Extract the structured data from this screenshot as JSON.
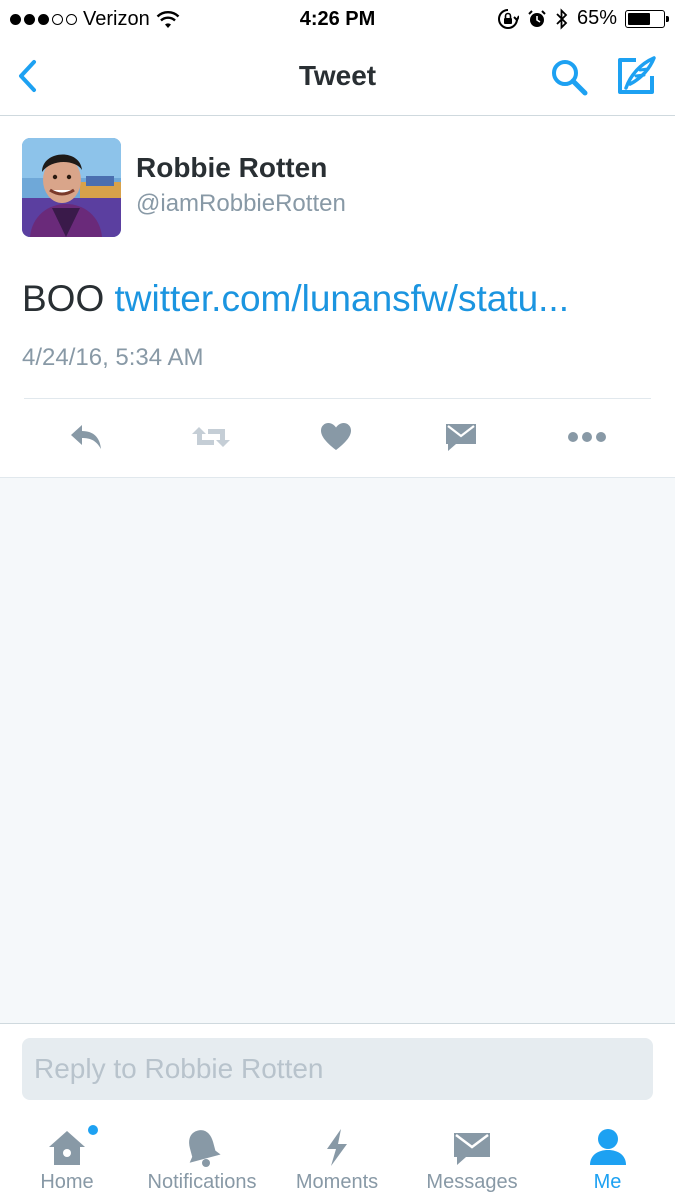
{
  "status_bar": {
    "carrier": "Verizon",
    "time": "4:26 PM",
    "battery": "65%",
    "battery_level": 0.65,
    "signal_bars_filled": 3,
    "signal_bars_total": 5
  },
  "nav": {
    "title": "Tweet",
    "back_icon": "chevron-left-icon",
    "search_icon": "search-icon",
    "compose_icon": "compose-icon"
  },
  "tweet": {
    "author_name": "Robbie Rotten",
    "author_handle": "@iamRobbieRotten",
    "text": "BOO",
    "link": "twitter.com/lunansfw/statu...",
    "timestamp": "4/24/16, 5:34 AM",
    "actions": [
      "reply-icon",
      "retweet-icon",
      "like-icon",
      "direct-message-icon",
      "more-icon"
    ]
  },
  "reply": {
    "placeholder": "Reply to Robbie Rotten"
  },
  "tabbar": {
    "tabs": [
      {
        "label": "Home",
        "icon": "home-icon",
        "has_badge": true
      },
      {
        "label": "Notifications",
        "icon": "bell-icon"
      },
      {
        "label": "Moments",
        "icon": "lightning-icon"
      },
      {
        "label": "Messages",
        "icon": "envelope-icon"
      },
      {
        "label": "Me",
        "icon": "person-icon",
        "active": true
      }
    ]
  },
  "colors": {
    "accent": "#1da1f2",
    "link": "#1b95e0",
    "icon_gray": "#8899a6",
    "background": "#f5f8fa"
  }
}
